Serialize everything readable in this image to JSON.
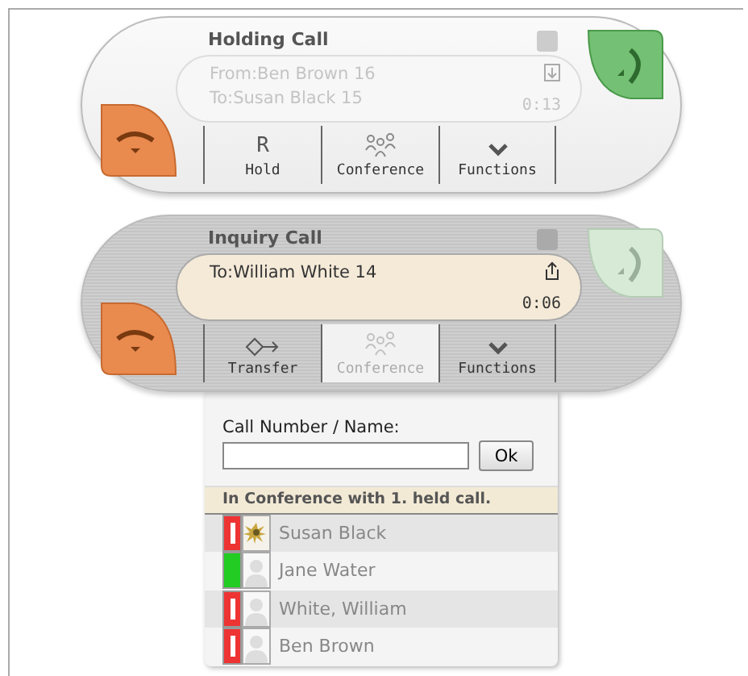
{
  "calls": [
    {
      "title": "Holding Call",
      "kind": "held",
      "lines": [
        "From:Ben Brown 16",
        "To:Susan Black 15"
      ],
      "time": "0:13",
      "answer_enabled": true,
      "buttons": [
        {
          "kind": "hold",
          "glyph": "R",
          "label": "Hold",
          "disabled": false
        },
        {
          "kind": "conference",
          "label": "Conference",
          "disabled": false
        },
        {
          "kind": "functions",
          "label": "Functions",
          "disabled": false
        }
      ]
    },
    {
      "title": "Inquiry Call",
      "kind": "active",
      "lines": [
        "To:William White 14"
      ],
      "time": "0:06",
      "answer_enabled": false,
      "buttons": [
        {
          "kind": "transfer",
          "label": "Transfer",
          "disabled": false
        },
        {
          "kind": "conference",
          "label": "Conference",
          "disabled": true
        },
        {
          "kind": "functions",
          "label": "Functions",
          "disabled": false
        }
      ]
    }
  ],
  "conference_panel": {
    "field_label": "Call Number / Name:",
    "ok_button": "Ok",
    "banner": "In Conference with 1. held call.",
    "contacts": [
      {
        "name": "Susan Black",
        "color": "#ee3333",
        "busy": true
      },
      {
        "name": "Jane Water",
        "color": "#22cc22",
        "busy": false,
        "kind": "silhouette"
      },
      {
        "name": "White, William",
        "color": "#ee3333",
        "busy": true,
        "kind": "silhouette"
      },
      {
        "name": "Ben Brown",
        "color": "#ee3333",
        "busy": true,
        "kind": "silhouette"
      }
    ]
  }
}
